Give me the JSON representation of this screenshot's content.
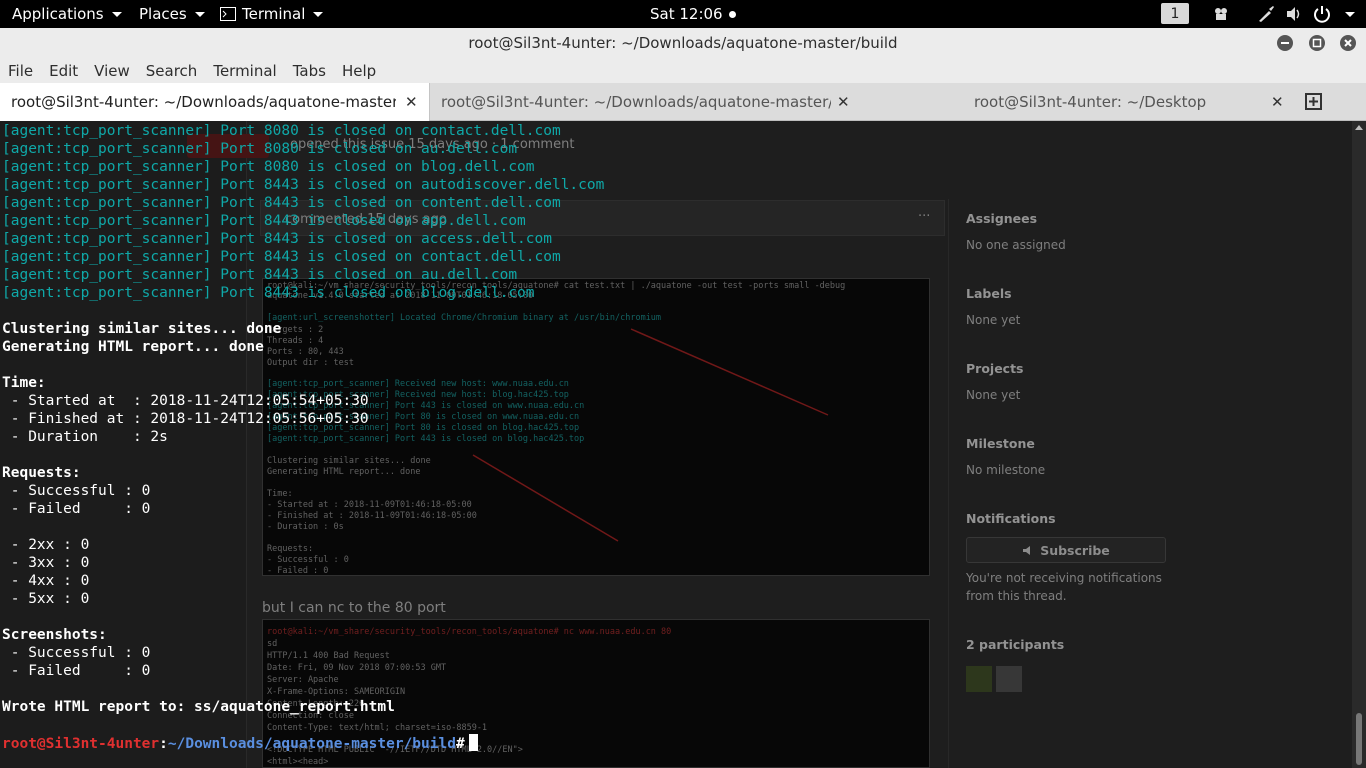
{
  "topbar": {
    "applications": "Applications",
    "places": "Places",
    "terminal": "Terminal",
    "clock": "Sat 12:06",
    "workspace": "1"
  },
  "window": {
    "title": "root@Sil3nt-4unter: ~/Downloads/aquatone-master/build"
  },
  "menubar": [
    "File",
    "Edit",
    "View",
    "Search",
    "Terminal",
    "Tabs",
    "Help"
  ],
  "tabs": [
    {
      "label": "root@Sil3nt-4unter: ~/Downloads/aquatone-master/bu..."
    },
    {
      "label": "root@Sil3nt-4unter: ~/Downloads/aquatone-master/bui..."
    },
    {
      "label": "root@Sil3nt-4unter: ~/Desktop"
    }
  ],
  "terminal": {
    "scanner_lines": [
      "[agent:tcp_port_scanner] Port 8080 is closed on contact.dell.com",
      "[agent:tcp_port_scanner] Port 8080 is closed on au.dell.com",
      "[agent:tcp_port_scanner] Port 8080 is closed on blog.dell.com",
      "[agent:tcp_port_scanner] Port 8443 is closed on autodiscover.dell.com",
      "[agent:tcp_port_scanner] Port 8443 is closed on content.dell.com",
      "[agent:tcp_port_scanner] Port 8443 is closed on app.dell.com",
      "[agent:tcp_port_scanner] Port 8443 is closed on access.dell.com",
      "[agent:tcp_port_scanner] Port 8443 is closed on contact.dell.com",
      "[agent:tcp_port_scanner] Port 8443 is closed on au.dell.com",
      "[agent:tcp_port_scanner] Port 8443 is closed on blog.dell.com"
    ],
    "clustering": "Clustering similar sites... done",
    "generating": "Generating HTML report... done",
    "time_header": "Time:",
    "started": " - Started at  : 2018-11-24T12:05:54+05:30",
    "finished": " - Finished at : 2018-11-24T12:05:56+05:30",
    "duration": " - Duration    : 2s",
    "requests_header": "Requests:",
    "req_success": " - Successful : 0",
    "req_failed": " - Failed     : 0",
    "c2xx": " - 2xx : 0",
    "c3xx": " - 3xx : 0",
    "c4xx": " - 4xx : 0",
    "c5xx": " - 5xx : 0",
    "screens_header": "Screenshots:",
    "scr_success": " - Successful : 0",
    "scr_failed": " - Failed     : 0",
    "wrote": "Wrote HTML report to: ss/aquatone_report.html",
    "prompt_user": "root@Sil3nt-4unter",
    "prompt_sep": ":",
    "prompt_path": "~/Downloads/aquatone-master/build",
    "prompt_hash": "#"
  },
  "background_page": {
    "issue_meta": "opened this issue 15 days ago · 1 comment",
    "commented": "commented 15 days ago",
    "nc_text": "but I can nc to the 80 port",
    "sidebar": [
      {
        "head": "Assignees",
        "value": "No one assigned"
      },
      {
        "head": "Labels",
        "value": "None yet"
      },
      {
        "head": "Projects",
        "value": "None yet"
      },
      {
        "head": "Milestone",
        "value": "No milestone"
      },
      {
        "head": "Notifications",
        "value": ""
      }
    ],
    "subscribe": "Subscribe",
    "notif_line1": "You're not receiving notifications",
    "notif_line2": "from this thread.",
    "participants": "2 participants",
    "shot1_lines": [
      "root@kali:~/vm_share/security_tools/recon_tools/aquatone# cat test.txt | ./aquatone -out test -ports small -debug",
      "aquatone v1.4.0 started at 2018-11-09T01:46:18-05:00",
      "[agent:url_screenshotter] Located Chrome/Chromium binary at /usr/bin/chromium",
      "Targets    : 2",
      "Threads    : 4",
      "Ports      : 80, 443",
      "Output dir : test",
      "[agent:tcp_port_scanner] Received new host: www.nuaa.edu.cn",
      "[agent:tcp_port_scanner] Received new host: blog.hac425.top",
      "[agent:tcp_port_scanner] Port 443 is closed on www.nuaa.edu.cn",
      "[agent:tcp_port_scanner] Port 80 is closed on www.nuaa.edu.cn",
      "[agent:tcp_port_scanner] Port 80 is closed on blog.hac425.top",
      "[agent:tcp_port_scanner] Port 443 is closed on blog.hac425.top",
      "Clustering similar sites... done",
      "Generating HTML report... done",
      "Time:",
      " - Started at  : 2018-11-09T01:46:18-05:00",
      " - Finished at : 2018-11-09T01:46:18-05:00",
      " - Duration    : 0s",
      "Requests:",
      " - Successful : 0",
      " - Failed     : 0"
    ],
    "shot2_lines": [
      "root@kali:~/vm_share/security_tools/recon_tools/aquatone# nc www.nuaa.edu.cn 80",
      "sd",
      "HTTP/1.1 400 Bad Request",
      "Date: Fri, 09 Nov 2018 07:00:53 GMT",
      "Server: Apache",
      "X-Frame-Options: SAMEORIGIN",
      "Content-Length: 226",
      "Connection: close",
      "Content-Type: text/html; charset=iso-8859-1",
      "<!DOCTYPE HTML PUBLIC \"-//IETF//DTD HTML 2.0//EN\">",
      "<html><head>"
    ]
  }
}
